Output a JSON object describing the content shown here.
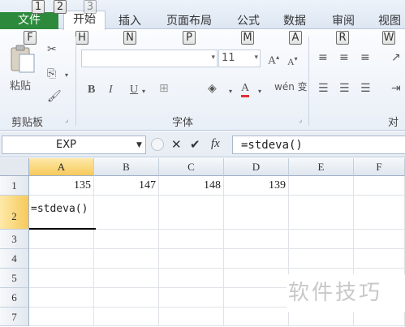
{
  "tabs": [
    {
      "label": "文件",
      "num": "1",
      "key": "F"
    },
    {
      "label": "开始",
      "num": "2",
      "key": "H"
    },
    {
      "label": "插入",
      "num": "3",
      "key": "N"
    },
    {
      "label": "页面布局",
      "key": "P"
    },
    {
      "label": "公式",
      "key": "M"
    },
    {
      "label": "数据",
      "key": "A"
    },
    {
      "label": "审阅",
      "key": "R"
    },
    {
      "label": "视图",
      "key": "W"
    }
  ],
  "ribbon": {
    "paste_label": "粘贴",
    "clipboard_group": "剪贴板",
    "font_group": "字体",
    "align_group": "对齐",
    "font_size": "11",
    "bold": "B",
    "italic": "I",
    "underline": "U",
    "grow_font": "A",
    "shrink_font": "A",
    "font_color": "A",
    "phonetic": "wén 变"
  },
  "formula_bar": {
    "name_box": "EXP",
    "cancel": "✕",
    "enter": "✔",
    "fx": "fx",
    "formula": "=stdeva()"
  },
  "sheet": {
    "columns": [
      "A",
      "B",
      "C",
      "D",
      "E",
      "F"
    ],
    "rows": [
      "1",
      "2",
      "3",
      "4",
      "5",
      "6",
      "7"
    ],
    "row1": [
      "135",
      "147",
      "148",
      "139"
    ],
    "a2": "=stdeva()"
  },
  "watermark": "软件技巧",
  "colors": {
    "file_tab": "#2d8a3c",
    "selected_header": "#f7c95b"
  }
}
